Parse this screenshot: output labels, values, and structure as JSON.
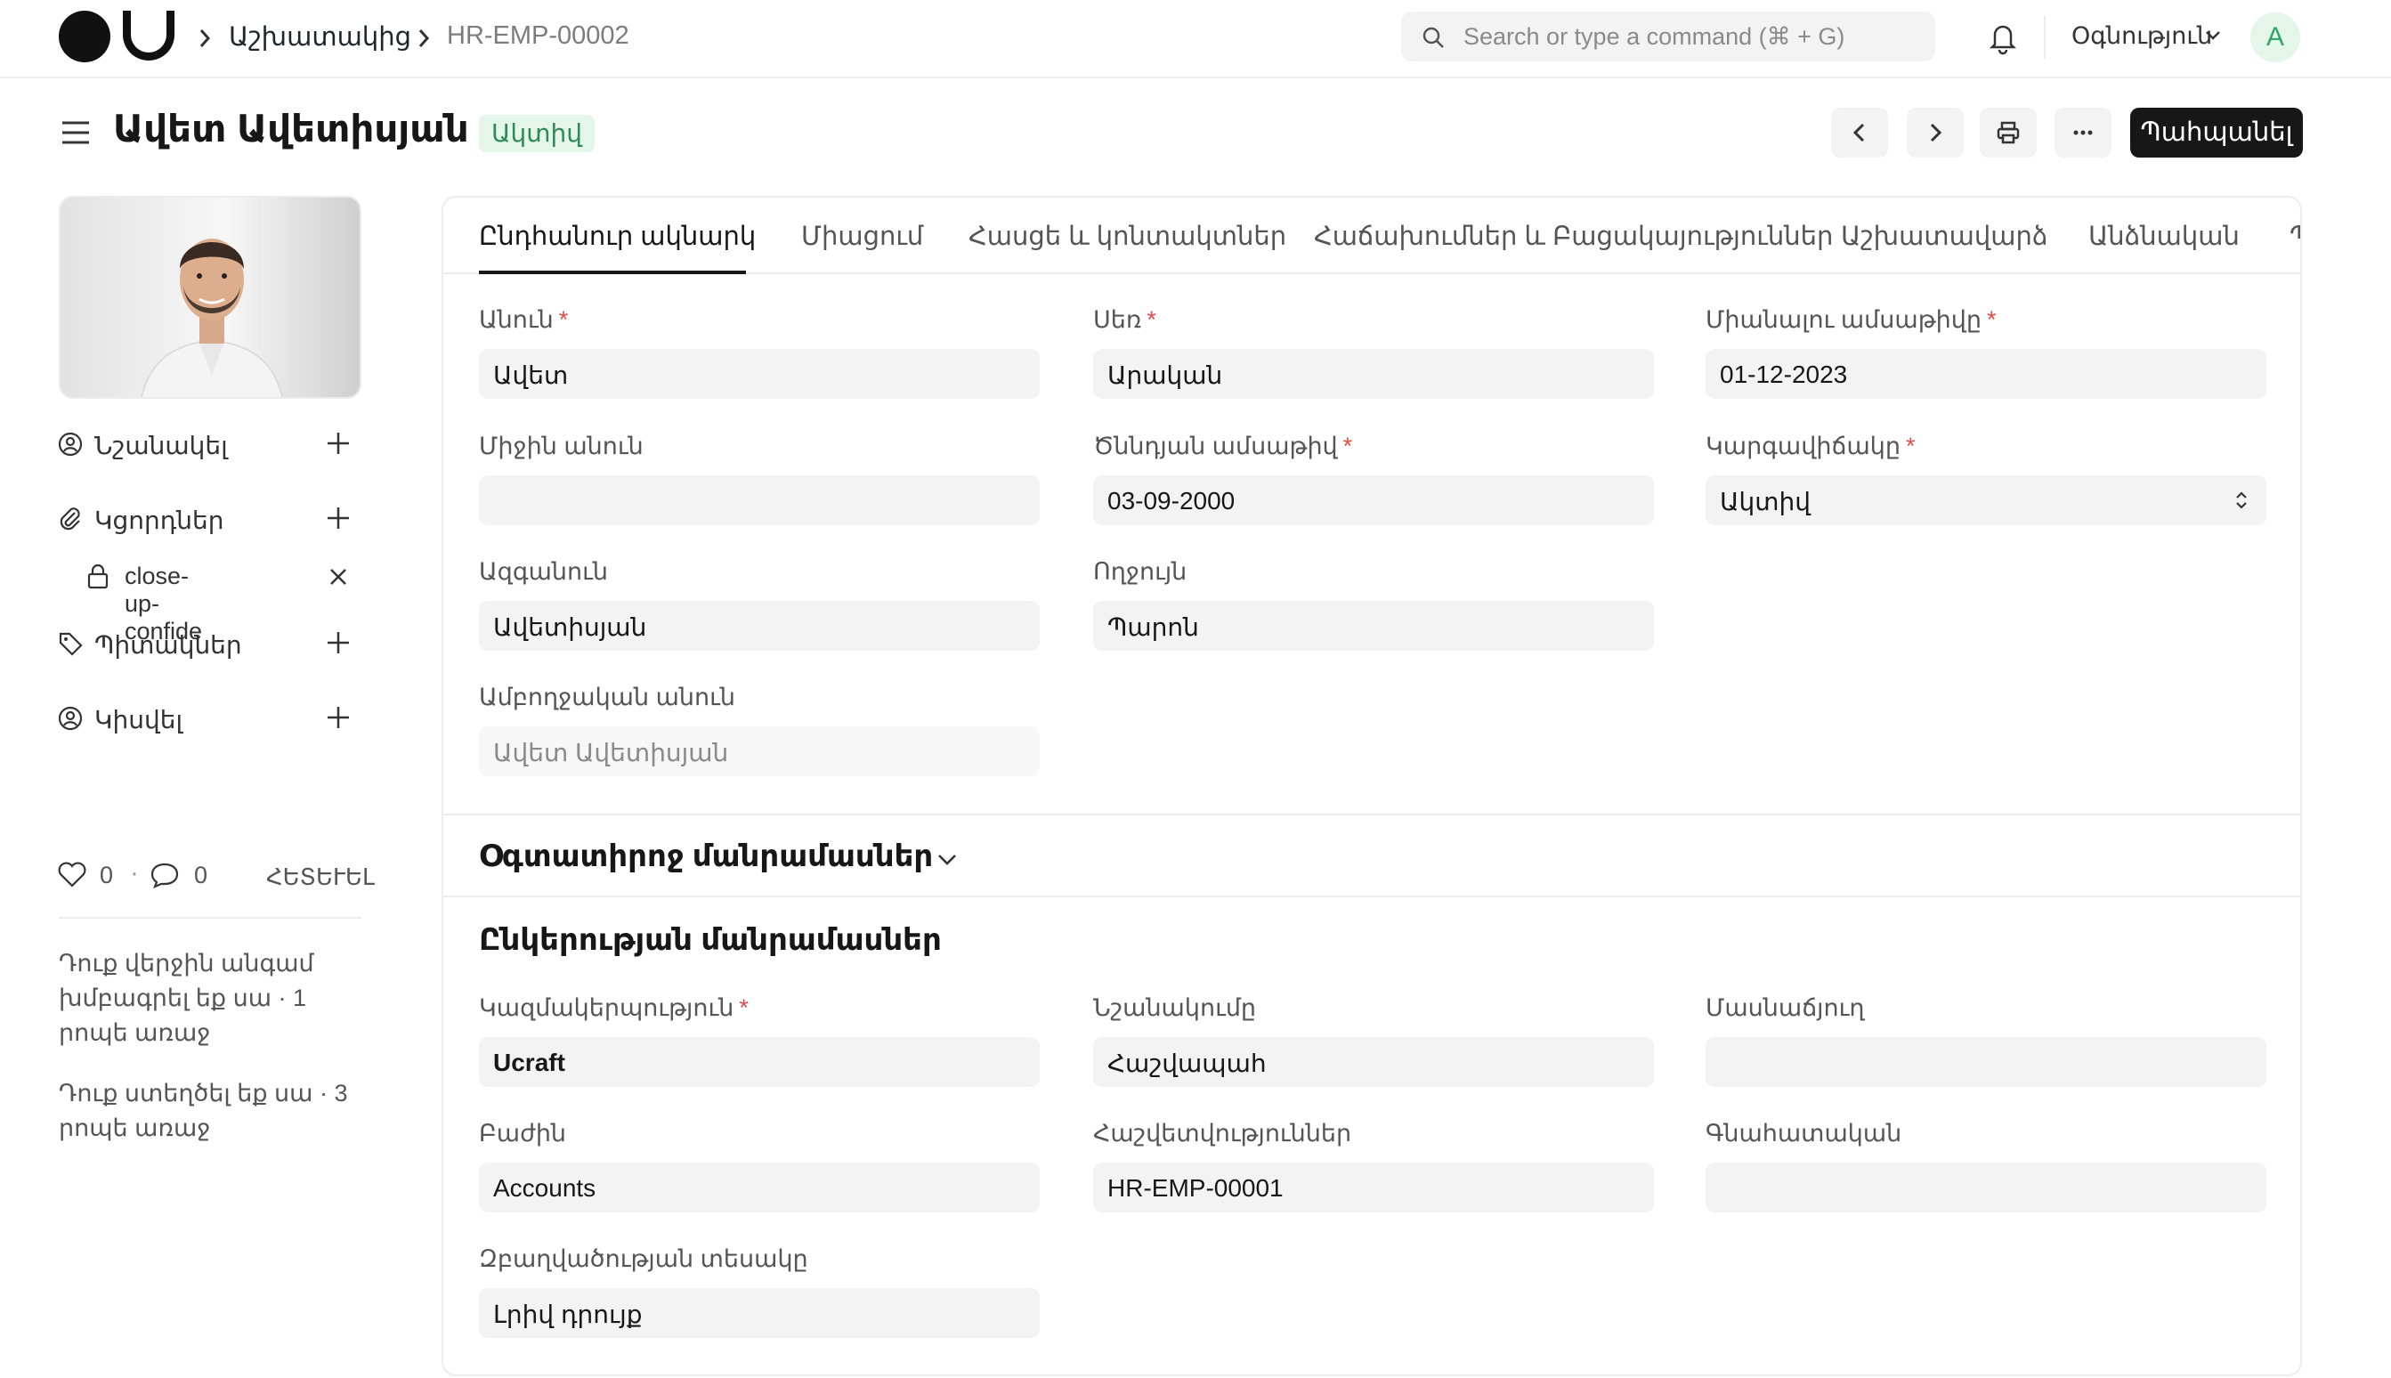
{
  "navbar": {
    "breadcrumb": [
      "Աշխատակից",
      "HR-EMP-00002"
    ],
    "search_placeholder": "Search or type a command (⌘ + G)",
    "help_label": "Օգնություն",
    "avatar_initial": "A"
  },
  "header": {
    "title": "Ավետ Ավետիսյան",
    "status": "Ակտիվ",
    "save_label": "Պահպանել"
  },
  "sidebar": {
    "assign_label": "Նշանակել",
    "attachments_label": "Կցորդներ",
    "attachment_file": "close-up-confide",
    "tags_label": "Պիտակներ",
    "share_label": "Կիսվել",
    "likes": "0",
    "comments": "0",
    "follow_label": "ՀԵՏԵՒԵԼ",
    "activity": [
      "Դուք վերջին անգամ խմբագրել եք սա · 1 րոպե առաջ",
      "Դուք ստեղծել եք սա · 3 րոպե առաջ"
    ]
  },
  "tabs": [
    "Ընդհանուր ակնարկ",
    "Միացում",
    "Հասցե և կոնտակտներ",
    "Հաճախումներ և Բացակայություններ",
    "Աշխատավարձ",
    "Անձնական",
    "Պ"
  ],
  "overview": {
    "first_name": {
      "label": "Անուն",
      "value": "Ավետ"
    },
    "gender": {
      "label": "Սեռ",
      "value": "Արական"
    },
    "joining_date": {
      "label": "Միանալու ամսաթիվը",
      "value": "01-12-2023"
    },
    "middle_name": {
      "label": "Միջին անուն",
      "value": ""
    },
    "birth_date": {
      "label": "Ծննդյան ամսաթիվ",
      "value": "03-09-2000"
    },
    "status": {
      "label": "Կարգավիճակը",
      "value": "Ակտիվ"
    },
    "last_name": {
      "label": "Ազգանուն",
      "value": "Ավետիսյան"
    },
    "salutation": {
      "label": "Ողջույն",
      "value": "Պարոն"
    },
    "full_name": {
      "label": "Ամբողջական անուն",
      "value": "Ավետ Ավետիսյան"
    }
  },
  "user_details": {
    "title": "Օգտատիրոջ մանրամասներ"
  },
  "company_details": {
    "title": "Ընկերության մանրամասներ",
    "company": {
      "label": "Կազմակերպություն",
      "value": "Ucraft"
    },
    "designation": {
      "label": "Նշանակումը",
      "value": "Հաշվապահ"
    },
    "branch": {
      "label": "Մասնաճյուղ",
      "value": ""
    },
    "department": {
      "label": "Բաժին",
      "value": "Accounts"
    },
    "reports_to": {
      "label": "Հաշվետվություններ",
      "value": "HR-EMP-00001"
    },
    "grade": {
      "label": "Գնահատական",
      "value": ""
    },
    "employment_type": {
      "label": "Զբաղվածության տեսակը",
      "value": "Լրիվ դրույք"
    }
  },
  "colors": {
    "accent": "#171717",
    "status_bg": "#e4f5e9",
    "status_text": "#2e8a58",
    "required": "#e24c4c"
  }
}
